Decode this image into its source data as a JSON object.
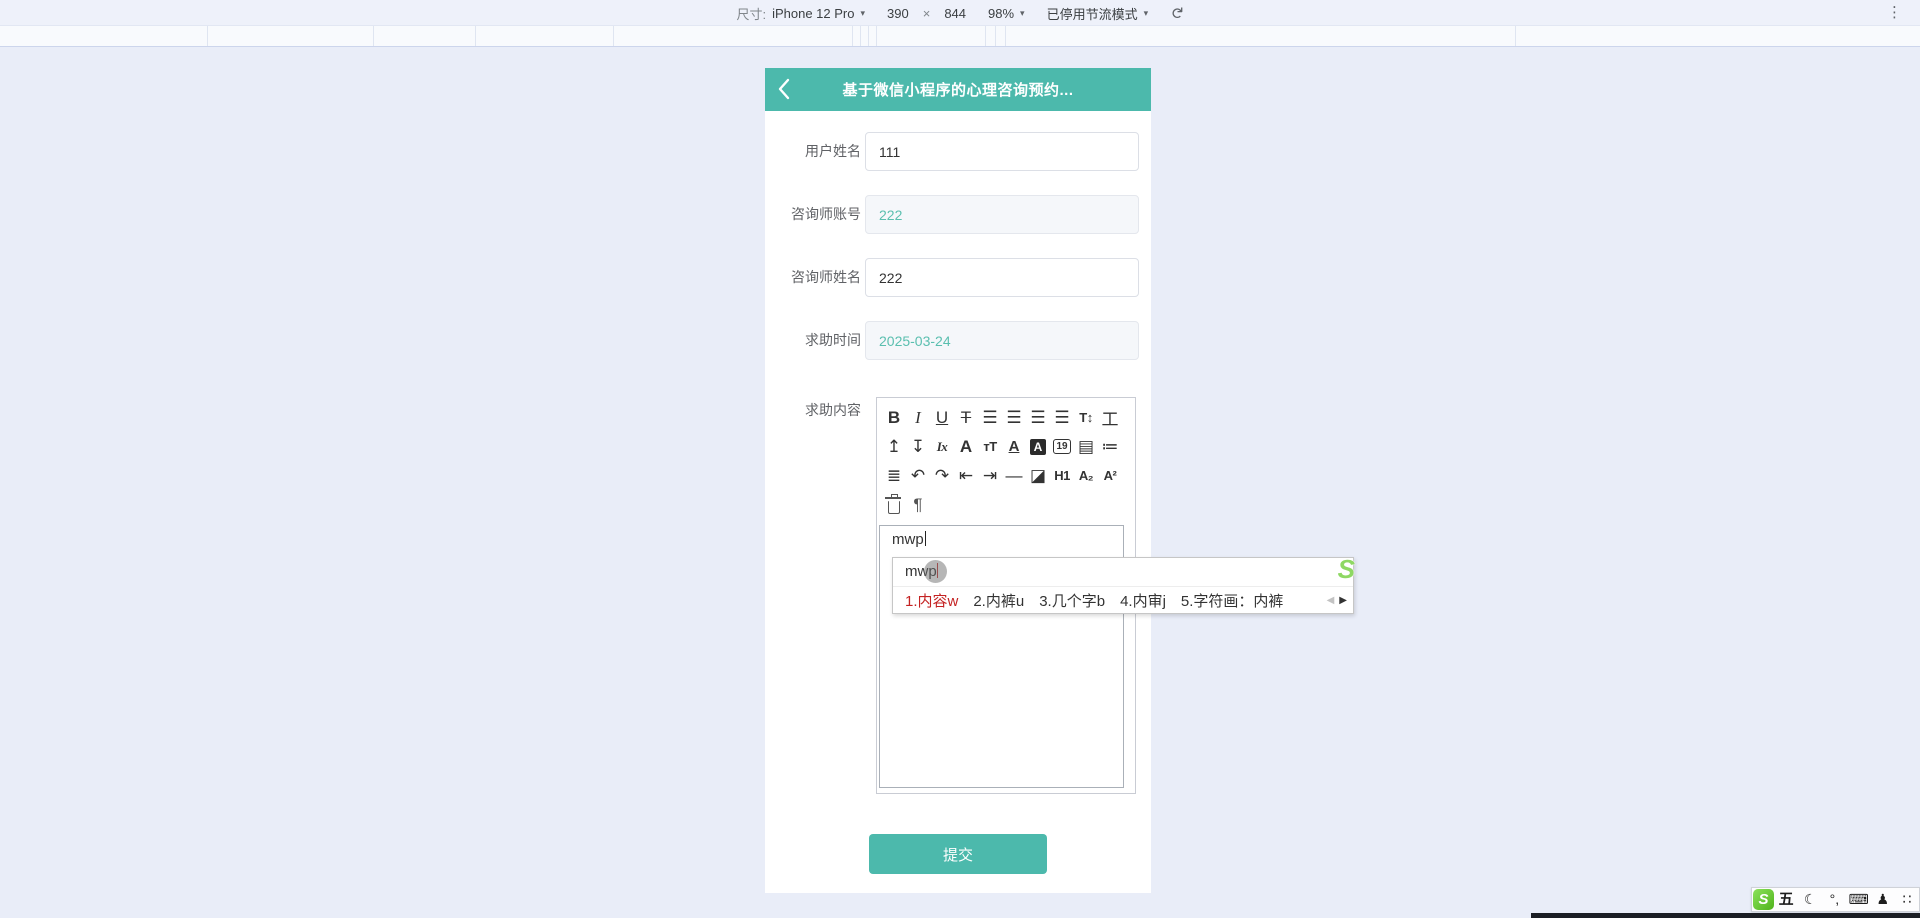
{
  "devtools": {
    "size_label": "尺寸:",
    "device": "iPhone 12 Pro",
    "viewport_width": "390",
    "multiply": "×",
    "viewport_height": "844",
    "zoom_level": "98%",
    "throttling": "已停用节流模式",
    "caret": "▾",
    "rotate_icon": "↻",
    "menu_icon": "⋮"
  },
  "app": {
    "title": "基于微信小程序的心理咨询预约...",
    "back_icon": "‹"
  },
  "form": {
    "fields": [
      {
        "label": "用户姓名",
        "value": "111",
        "disabled": false
      },
      {
        "label": "咨询师账号",
        "value": "222",
        "disabled": true
      },
      {
        "label": "咨询师姓名",
        "value": "222",
        "disabled": false
      },
      {
        "label": "求助时间",
        "value": "2025-03-24",
        "disabled": true
      },
      {
        "label": "求助内容"
      }
    ],
    "submit_label": "提交"
  },
  "editor": {
    "content": "mwp",
    "toolbar": [
      {
        "name": "bold",
        "glyph": "B"
      },
      {
        "name": "italic",
        "glyph": "I"
      },
      {
        "name": "underline",
        "glyph": "U"
      },
      {
        "name": "strikethrough",
        "glyph": "T"
      },
      {
        "name": "align-left",
        "glyph": "☰"
      },
      {
        "name": "align-center",
        "glyph": "☰"
      },
      {
        "name": "align-right",
        "glyph": "☰"
      },
      {
        "name": "align-justify",
        "glyph": "☰"
      },
      {
        "name": "line-height",
        "glyph": "T↕"
      },
      {
        "name": "letter-spacing",
        "glyph": "工"
      },
      {
        "name": "indent-top",
        "glyph": "↥"
      },
      {
        "name": "line-spacing",
        "glyph": "↧"
      },
      {
        "name": "clear-format",
        "glyph": "Ix"
      },
      {
        "name": "font-size",
        "glyph": "A"
      },
      {
        "name": "font-family",
        "glyph": "тT"
      },
      {
        "name": "font-color",
        "glyph": "A"
      },
      {
        "name": "background-color",
        "glyph": "A"
      },
      {
        "name": "insert-date",
        "glyph": "19"
      },
      {
        "name": "clipboard",
        "glyph": "▤"
      },
      {
        "name": "bullet-list",
        "glyph": "≔"
      },
      {
        "name": "numbered-list",
        "glyph": "≣"
      },
      {
        "name": "undo",
        "glyph": "↶"
      },
      {
        "name": "redo",
        "glyph": "↷"
      },
      {
        "name": "outdent",
        "glyph": "⇤"
      },
      {
        "name": "indent",
        "glyph": "⇥"
      },
      {
        "name": "horizontal-rule",
        "glyph": "—"
      },
      {
        "name": "insert-image",
        "glyph": "◪"
      },
      {
        "name": "heading-1",
        "glyph": "H1"
      },
      {
        "name": "subscript",
        "glyph": "A₂"
      },
      {
        "name": "superscript",
        "glyph": "A²"
      },
      {
        "name": "trash",
        "glyph": ""
      },
      {
        "name": "paragraph-mark",
        "glyph": "¶"
      }
    ]
  },
  "ime": {
    "composition": "mwp",
    "candidates": [
      "1.内容w",
      "2.内裤u",
      "3.几个字b",
      "4.内审j",
      "5.字符画：内裤"
    ],
    "prev_icon": "◀",
    "next_icon": "▶",
    "logo": "S"
  },
  "sogou_bar": {
    "logo": "S",
    "items": [
      {
        "name": "wubi-mode",
        "glyph": "五"
      },
      {
        "name": "half-full-width-moon",
        "glyph": "☾"
      },
      {
        "name": "punctuation-mode",
        "glyph": "°,"
      },
      {
        "name": "soft-keyboard",
        "glyph": "⌨"
      },
      {
        "name": "account",
        "glyph": "♟"
      },
      {
        "name": "toolbox",
        "glyph": "∷"
      }
    ]
  },
  "colors": {
    "accent_teal": "#4cb9ac",
    "disabled_value_text": "#5abfaf",
    "selected_candidate_red": "#c42222",
    "page_background": "#e9edf8",
    "sogou_green": "#6fce3e"
  }
}
